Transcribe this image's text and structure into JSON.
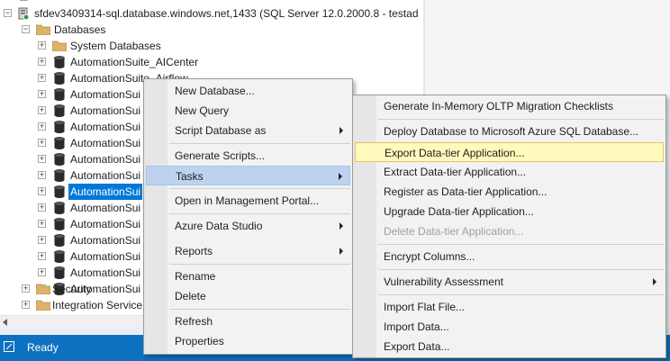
{
  "object_explorer": {
    "server": {
      "label": "sfdev3409314-sql.database.windows.net,1433 (SQL Server 12.0.2000.8 - testad"
    },
    "databases_label": "Databases",
    "system_databases_label": "System Databases",
    "databases": [
      "AutomationSuite_AICenter",
      "AutomationSuite_Airflow",
      "AutomationSui",
      "AutomationSui",
      "AutomationSui",
      "AutomationSui",
      "AutomationSui",
      "AutomationSui",
      "AutomationSui",
      "AutomationSui",
      "AutomationSui",
      "AutomationSui",
      "AutomationSui",
      "AutomationSui",
      "AutomationSui"
    ],
    "selected_index": 8,
    "security_label": "Security",
    "integration_label": "Integration Service"
  },
  "context_menu": {
    "items": [
      {
        "label": "New Database...",
        "submenu": false
      },
      {
        "label": "New Query",
        "submenu": false
      },
      {
        "label": "Script Database as",
        "submenu": true
      },
      {
        "label": "Generate Scripts...",
        "submenu": false
      },
      {
        "label": "Tasks",
        "submenu": true
      },
      {
        "label": "Open in Management Portal...",
        "submenu": false
      },
      {
        "label": "Azure Data Studio",
        "submenu": true
      },
      {
        "label": "Reports",
        "submenu": true
      },
      {
        "label": "Rename",
        "submenu": false
      },
      {
        "label": "Delete",
        "submenu": false
      },
      {
        "label": "Refresh",
        "submenu": false
      },
      {
        "label": "Properties",
        "submenu": false
      }
    ]
  },
  "tasks_menu": {
    "items": [
      {
        "label": "Generate In-Memory OLTP Migration Checklists"
      },
      {
        "label": "Deploy Database to Microsoft Azure SQL Database..."
      },
      {
        "label": "Export Data-tier Application..."
      },
      {
        "label": "Extract Data-tier Application..."
      },
      {
        "label": "Register as Data-tier Application..."
      },
      {
        "label": "Upgrade Data-tier Application..."
      },
      {
        "label": "Delete Data-tier Application..."
      },
      {
        "label": "Encrypt Columns..."
      },
      {
        "label": "Vulnerability Assessment"
      },
      {
        "label": "Import Flat File..."
      },
      {
        "label": "Import Data..."
      },
      {
        "label": "Export Data..."
      }
    ]
  },
  "statusbar": {
    "text": "Ready"
  },
  "colors": {
    "selection": "#0078d7",
    "statusbar": "#0e70c0",
    "menu_hover": "#bcd2ef",
    "menu_target": "#fff9bc"
  },
  "icons": [
    "server-icon",
    "folder-icon",
    "database-icon",
    "expand-icon",
    "collapse-icon",
    "submenu-arrow-icon",
    "status-icon"
  ]
}
